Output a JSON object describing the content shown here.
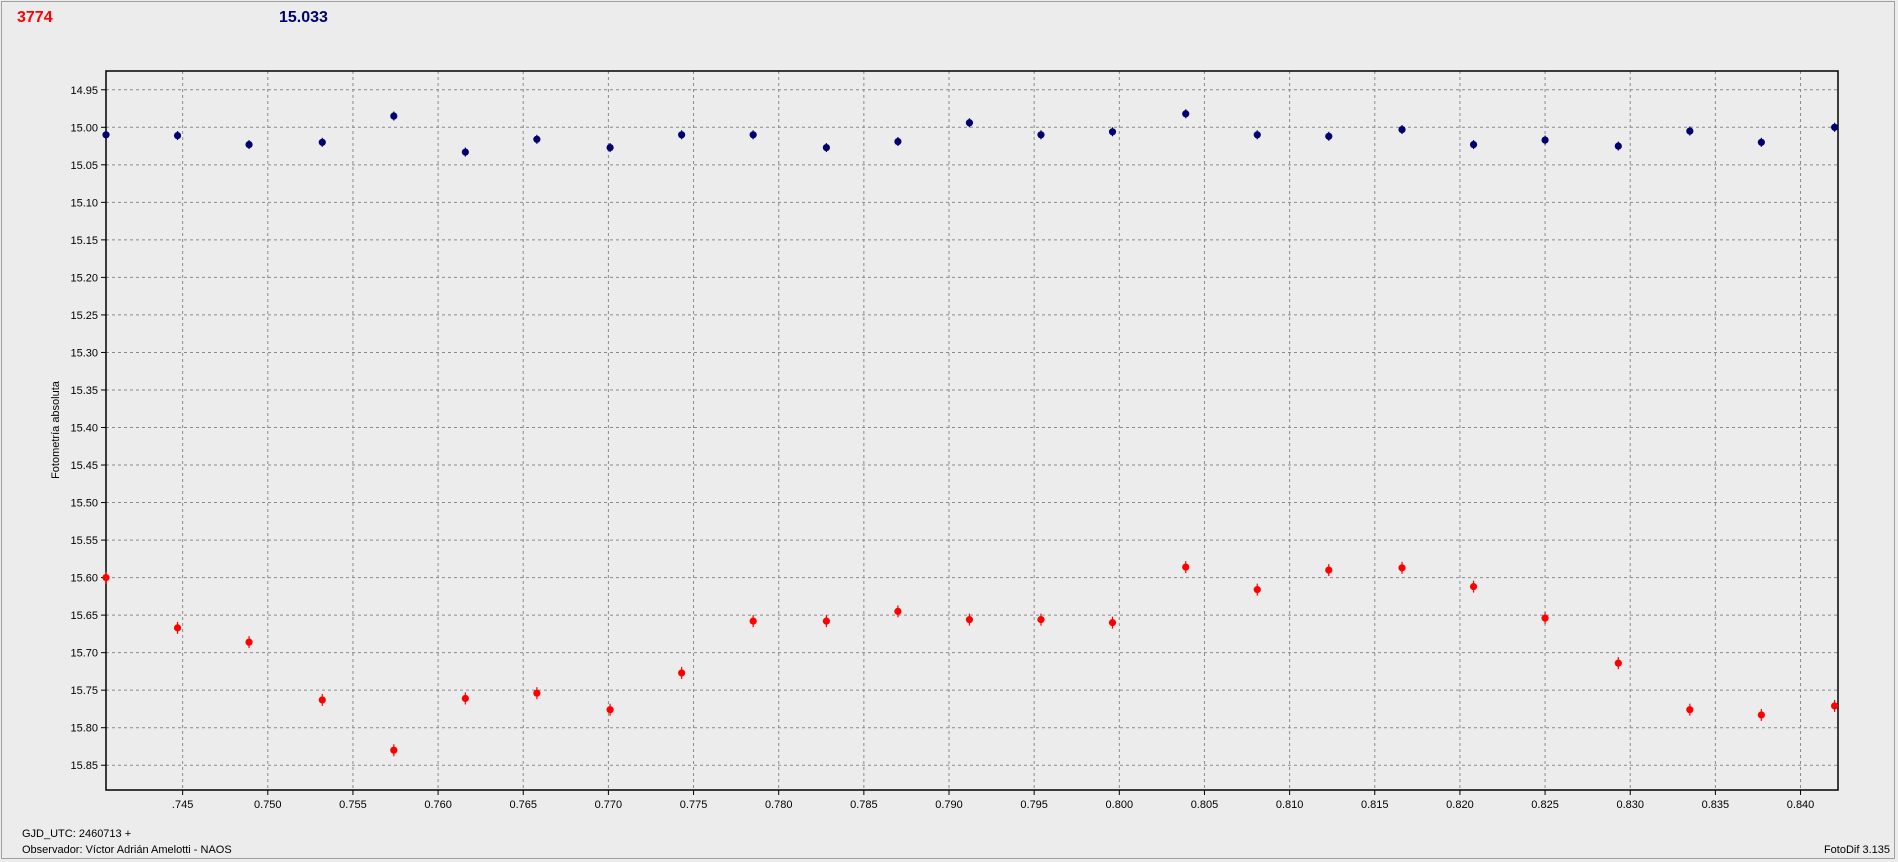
{
  "header": {
    "target_id": "3774",
    "comparison_value": "15.033"
  },
  "footer": {
    "epoch": "GJD_UTC: 2460713 +",
    "observer": "Observador: Víctor Adrián Amelotti - NAOS",
    "software": "FotoDif 3.135"
  },
  "chart_data": {
    "type": "scatter",
    "ylabel": "Fotometría absoluta",
    "xlabel": "",
    "xlim": [
      0.7405,
      0.8422
    ],
    "ylim": [
      14.925,
      15.883
    ],
    "y_inverted": true,
    "grid": true,
    "x_ticks": [
      0.745,
      0.75,
      0.755,
      0.76,
      0.765,
      0.77,
      0.775,
      0.78,
      0.785,
      0.79,
      0.795,
      0.8,
      0.805,
      0.81,
      0.815,
      0.82,
      0.825,
      0.83,
      0.835,
      0.84
    ],
    "x_tick_labels": [
      ".745",
      "0.750",
      "0.755",
      "0.760",
      "0.765",
      "0.770",
      "0.775",
      "0.780",
      "0.785",
      "0.790",
      "0.795",
      "0.800",
      "0.805",
      "0.810",
      "0.815",
      "0.820",
      "0.825",
      "0.830",
      "0.835",
      "0.840"
    ],
    "y_ticks": [
      14.95,
      15.0,
      15.05,
      15.1,
      15.15,
      15.2,
      15.25,
      15.3,
      15.35,
      15.4,
      15.45,
      15.5,
      15.55,
      15.6,
      15.65,
      15.7,
      15.75,
      15.8,
      15.85
    ],
    "y_tick_labels": [
      "14.95",
      "15.00",
      "15.05",
      "15.10",
      "15.15",
      "15.20",
      "15.25",
      "15.30",
      "15.35",
      "15.40",
      "15.45",
      "15.50",
      "15.55",
      "15.60",
      "15.65",
      "15.70",
      "15.75",
      "15.80",
      "15.85"
    ],
    "x": [
      0.7405,
      0.7447,
      0.7489,
      0.7532,
      0.7574,
      0.7616,
      0.7658,
      0.7701,
      0.7743,
      0.7785,
      0.7828,
      0.787,
      0.7912,
      0.7954,
      0.7996,
      0.8039,
      0.8081,
      0.8123,
      0.8166,
      0.8208,
      0.825,
      0.8293,
      0.8335,
      0.8377,
      0.842
    ],
    "series": [
      {
        "color": "#00006e",
        "values": [
          15.01,
          15.011,
          15.023,
          15.02,
          14.985,
          15.033,
          15.016,
          15.027,
          15.01,
          15.01,
          15.027,
          15.019,
          14.994,
          15.01,
          15.006,
          14.982,
          15.01,
          15.012,
          15.003,
          15.023,
          15.017,
          15.025,
          15.005,
          15.02,
          15.0
        ],
        "error": 0.006
      },
      {
        "color": "#ff0000",
        "values": [
          15.6,
          15.667,
          15.686,
          15.763,
          15.83,
          15.761,
          15.754,
          15.776,
          15.727,
          15.658,
          15.658,
          15.645,
          15.656,
          15.656,
          15.66,
          15.586,
          15.616,
          15.59,
          15.587,
          15.612,
          15.654,
          15.714,
          15.776,
          15.783,
          15.771
        ]
      }
    ],
    "error": 0.008
  }
}
